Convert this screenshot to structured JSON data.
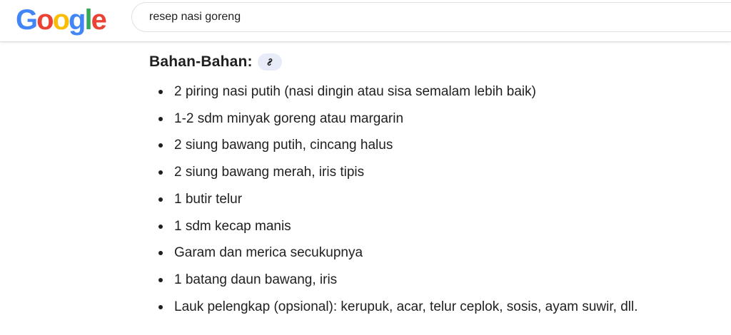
{
  "logo": {
    "letters": [
      {
        "char": "G",
        "color": "#4285F4"
      },
      {
        "char": "o",
        "color": "#EA4335"
      },
      {
        "char": "o",
        "color": "#FBBC05"
      },
      {
        "char": "g",
        "color": "#4285F4"
      },
      {
        "char": "l",
        "color": "#34A853"
      },
      {
        "char": "e",
        "color": "#EA4335"
      }
    ]
  },
  "search": {
    "value": "resep nasi goreng"
  },
  "section": {
    "title": "Bahan-Bahan:",
    "link_icon": "link-icon"
  },
  "ingredients": [
    "2 piring nasi putih (nasi dingin atau sisa semalam lebih baik)",
    "1-2 sdm minyak goreng atau margarin",
    "2 siung bawang putih, cincang halus",
    "2 siung bawang merah, iris tipis",
    "1 butir telur",
    "1 sdm kecap manis",
    "Garam dan merica secukupnya",
    "1 batang daun bawang, iris",
    "Lauk pelengkap (opsional): kerupuk, acar, telur ceplok, sosis, ayam suwir, dll."
  ]
}
